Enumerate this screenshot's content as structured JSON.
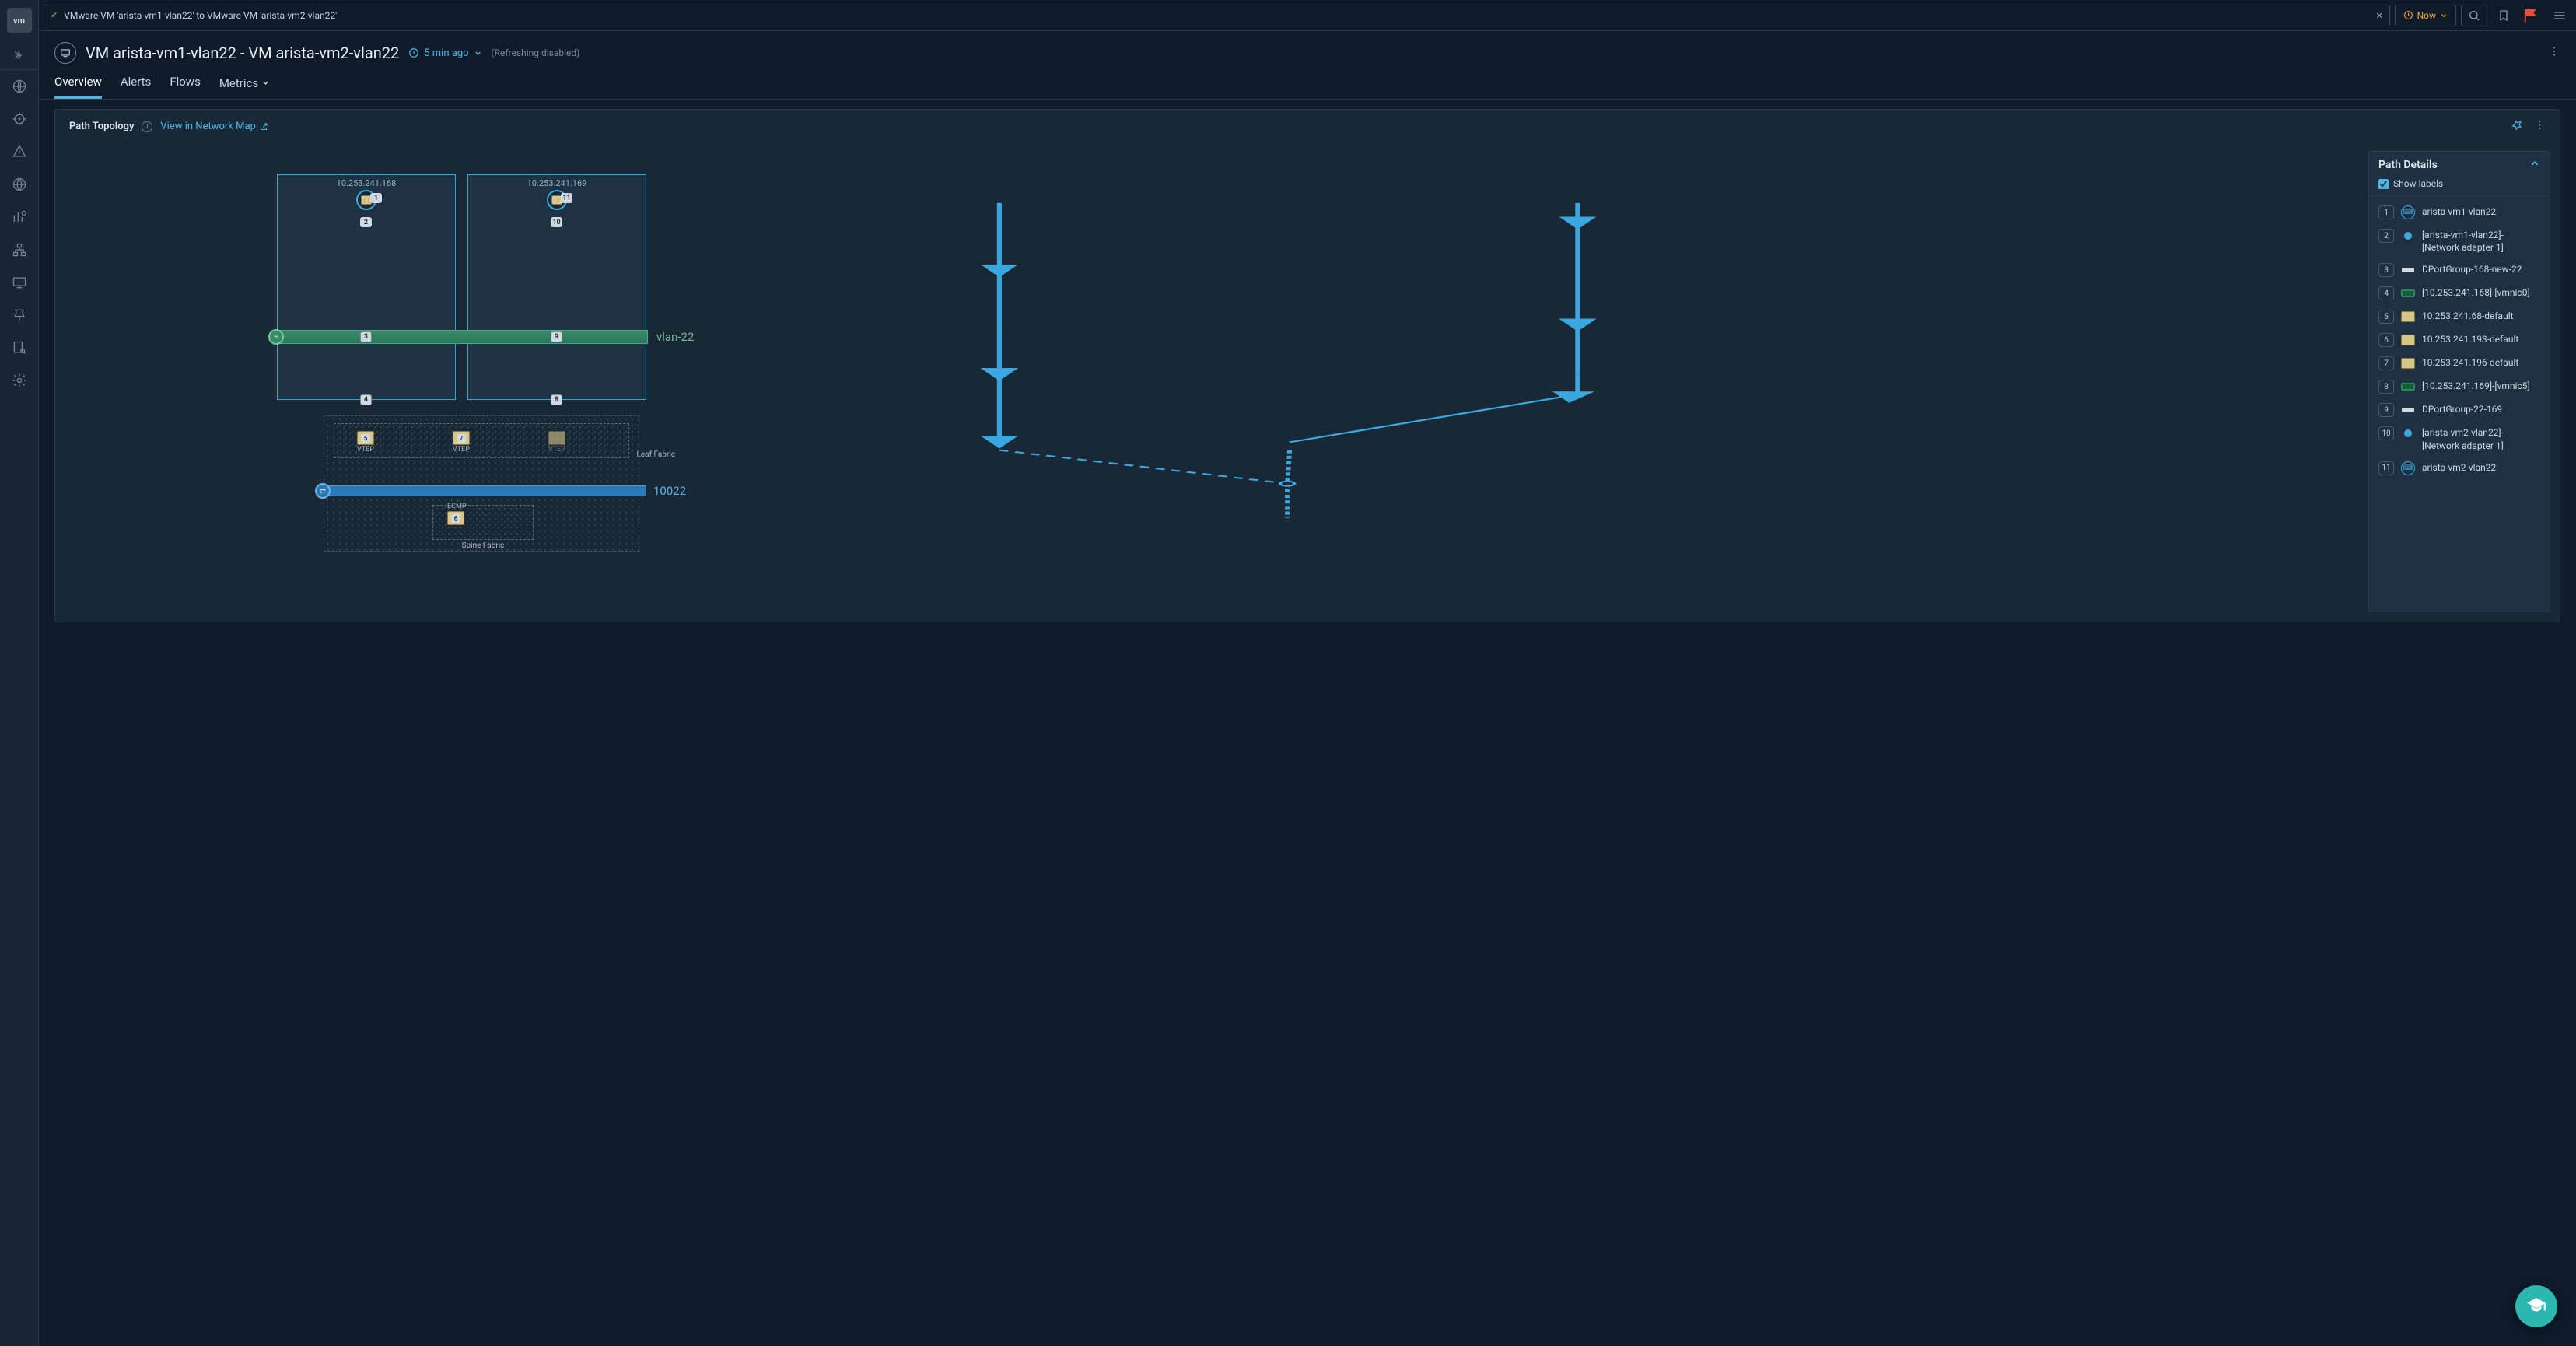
{
  "topbar": {
    "search_text": "VMware VM 'arista-vm1-vlan22' to VMware VM 'arista-vm2-vlan22'",
    "now_label": "Now"
  },
  "header": {
    "title": "VM arista-vm1-vlan22 - VM arista-vm2-vlan22",
    "time_ago": "5 min ago",
    "refresh_status": "(Refreshing disabled)"
  },
  "tabs": {
    "overview": "Overview",
    "alerts": "Alerts",
    "flows": "Flows",
    "metrics": "Metrics"
  },
  "panel": {
    "title": "Path Topology",
    "view_link": "View in Network Map"
  },
  "topology": {
    "host1_ip": "10.253.241.168",
    "host2_ip": "10.253.241.169",
    "vlan_label": "vlan-22",
    "vni_label": "10022",
    "leaf_label": "Leaf Fabric",
    "spine_label": "Spine Fabric",
    "vtep": "VTEP",
    "ecmp": "ECMP",
    "hops": {
      "h1": "1",
      "h2": "2",
      "h3": "3",
      "h4": "4",
      "h5": "5",
      "h6": "6",
      "h7": "7",
      "h8": "8",
      "h9": "9",
      "h10": "10",
      "h11": "11"
    }
  },
  "path_details": {
    "title": "Path Details",
    "show_labels": "Show labels",
    "items": [
      {
        "n": "1",
        "icon": "vm",
        "label": "arista-vm1-vlan22"
      },
      {
        "n": "2",
        "icon": "dot",
        "label": "[arista-vm1-vlan22]-[Network adapter 1]"
      },
      {
        "n": "3",
        "icon": "bar",
        "label": "DPortGroup-168-new-22"
      },
      {
        "n": "4",
        "icon": "nic",
        "label": "[10.253.241.168]-[vmnic0]"
      },
      {
        "n": "5",
        "icon": "sw",
        "label": "10.253.241.68-default"
      },
      {
        "n": "6",
        "icon": "sw",
        "label": "10.253.241.193-default"
      },
      {
        "n": "7",
        "icon": "sw",
        "label": "10.253.241.196-default"
      },
      {
        "n": "8",
        "icon": "nic",
        "label": "[10.253.241.169]-[vmnic5]"
      },
      {
        "n": "9",
        "icon": "bar",
        "label": "DPortGroup-22-169"
      },
      {
        "n": "10",
        "icon": "dot",
        "label": "[arista-vm2-vlan22]-[Network adapter 1]"
      },
      {
        "n": "11",
        "icon": "vm",
        "label": "arista-vm2-vlan22"
      }
    ]
  }
}
